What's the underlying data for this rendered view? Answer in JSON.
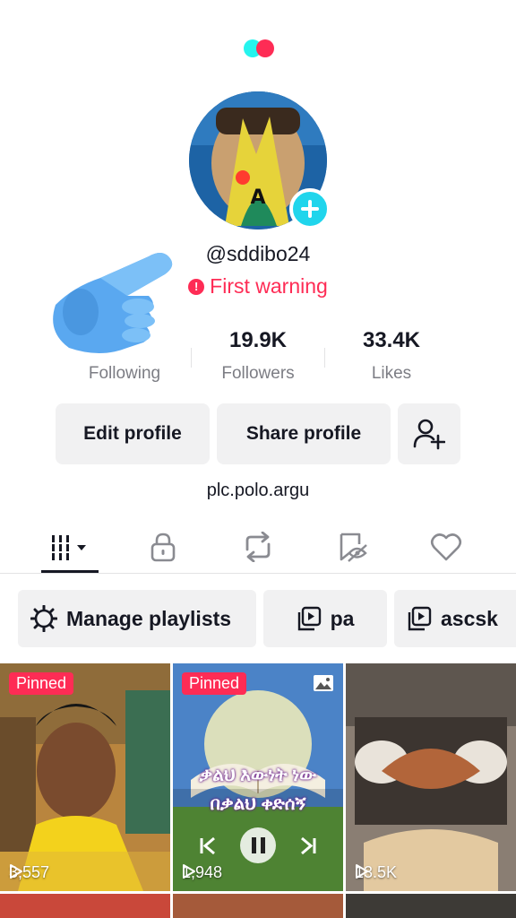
{
  "profile": {
    "username": "@sddibo24",
    "warning_text": "First warning",
    "bio_link": "plc.polo.argu"
  },
  "stats": {
    "following": {
      "value": "",
      "label": "Following"
    },
    "followers": {
      "value": "19.9K",
      "label": "Followers"
    },
    "likes": {
      "value": "33.4K",
      "label": "Likes"
    }
  },
  "buttons": {
    "edit_profile": "Edit profile",
    "share_profile": "Share profile"
  },
  "tabs": [
    {
      "icon": "grid-dropdown-icon",
      "active": true
    },
    {
      "icon": "lock-icon",
      "active": false
    },
    {
      "icon": "repost-icon",
      "active": false
    },
    {
      "icon": "bookmark-eye-icon",
      "active": false
    },
    {
      "icon": "heart-icon",
      "active": false
    }
  ],
  "playlists": {
    "manage_label": "Manage playlists",
    "items": [
      "pa",
      "ascsk"
    ]
  },
  "videos": [
    {
      "pinned_label": "Pinned",
      "views": "3,557"
    },
    {
      "pinned_label": "Pinned",
      "views": "1,948",
      "overlay_line1": "ቃልህ እውነት ነው",
      "overlay_line2": "በቃልህ ቀድሰኝ"
    },
    {
      "views": "13.5K"
    }
  ],
  "colors": {
    "accent_red": "#fe2c55",
    "accent_cyan": "#20d5ec",
    "button_bg": "#f1f1f2",
    "secondary_text": "#7c7d84"
  }
}
